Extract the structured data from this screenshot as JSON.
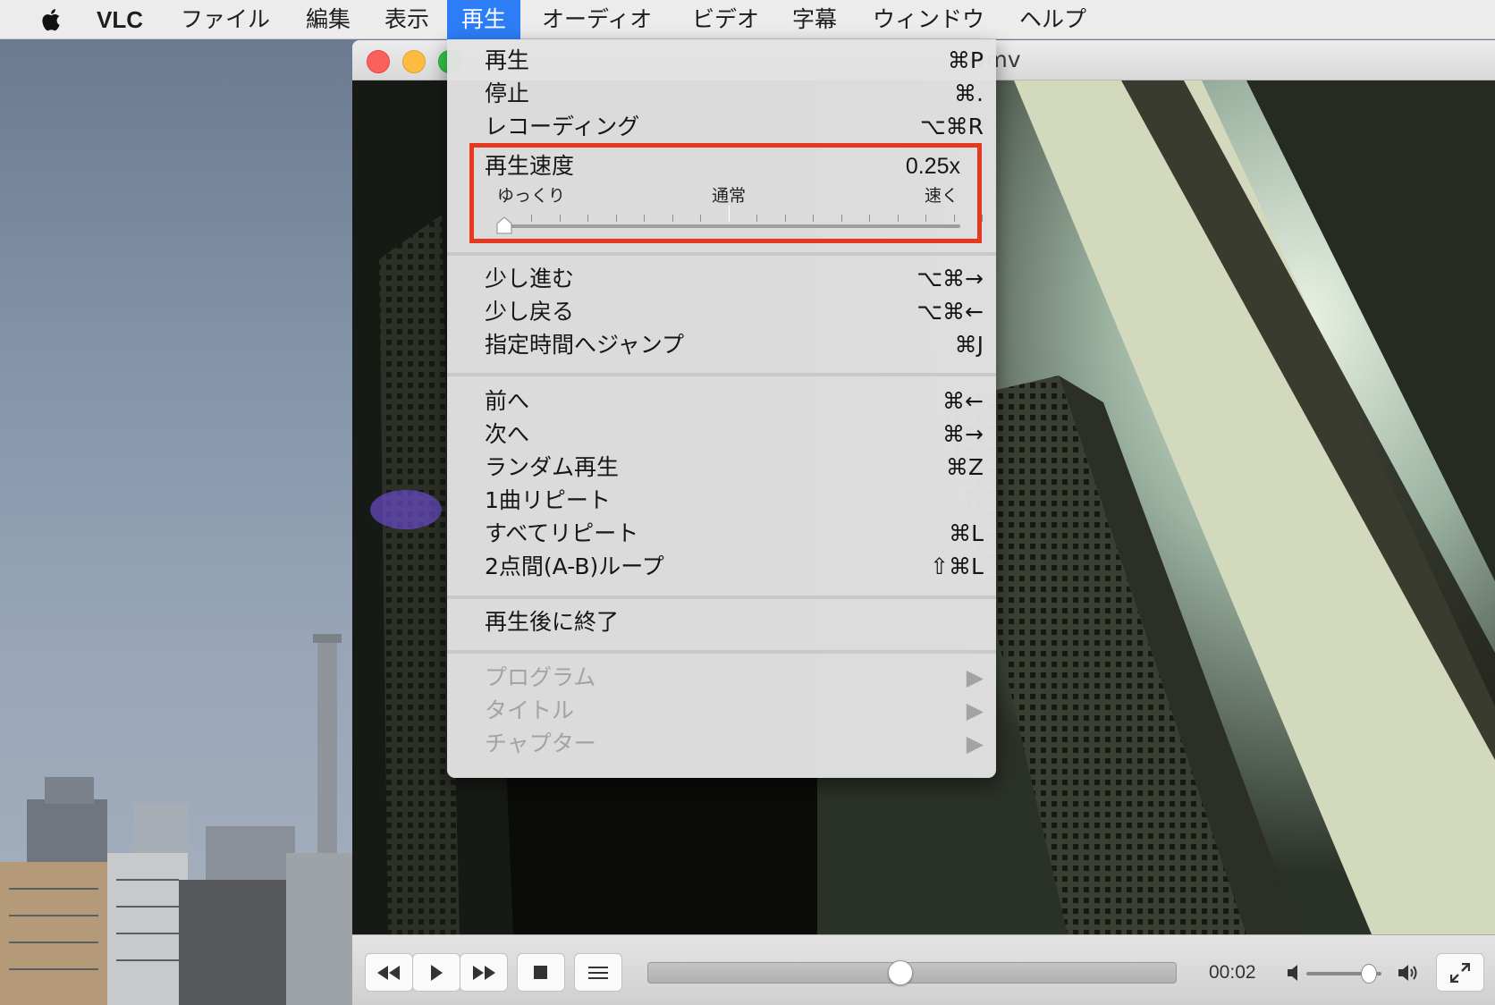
{
  "menubar": {
    "app_name": "VLC",
    "items": [
      "ファイル",
      "編集",
      "表示",
      "再生",
      "オーディオ",
      "ビデオ",
      "字幕",
      "ウィンドウ",
      "ヘルプ"
    ],
    "active_index": 3
  },
  "window": {
    "title_fragment": "wmv"
  },
  "menu": {
    "group1": [
      {
        "label": "再生",
        "shortcut": "⌘P"
      },
      {
        "label": "停止",
        "shortcut": "⌘."
      },
      {
        "label": "レコーディング",
        "shortcut": "⌥⌘R"
      }
    ],
    "speed": {
      "label": "再生速度",
      "value": "0.25x",
      "slow_label": "ゆっくり",
      "normal_label": "通常",
      "fast_label": "速く",
      "level": 0.0
    },
    "group2": [
      {
        "label": "少し進む",
        "shortcut": "⌥⌘→"
      },
      {
        "label": "少し戻る",
        "shortcut": "⌥⌘←"
      },
      {
        "label": "指定時間へジャンプ",
        "shortcut": "⌘J"
      }
    ],
    "group3": [
      {
        "label": "前へ",
        "shortcut": "⌘←"
      },
      {
        "label": "次へ",
        "shortcut": "⌘→"
      },
      {
        "label": "ランダム再生",
        "shortcut": "⌘Z"
      },
      {
        "label": "1曲リピート",
        "shortcut": ""
      },
      {
        "label": "すべてリピート",
        "shortcut": "⌘L"
      },
      {
        "label": "2点間(A-B)ループ",
        "shortcut": "⇧⌘L"
      }
    ],
    "group4": [
      {
        "label": "再生後に終了",
        "shortcut": ""
      }
    ],
    "group5": [
      {
        "label": "プログラム",
        "shortcut": "▶"
      },
      {
        "label": "タイトル",
        "shortcut": "▶"
      },
      {
        "label": "チャプター",
        "shortcut": "▶"
      }
    ]
  },
  "controls": {
    "time": "00:02",
    "seek_progress": 0.48,
    "volume_level": 0.82
  },
  "colors": {
    "menubar_active": "#2d7df6",
    "highlight_box": "#e6381f",
    "close": "#fc605c",
    "minimize": "#fdbc40",
    "zoom": "#34c84a"
  }
}
